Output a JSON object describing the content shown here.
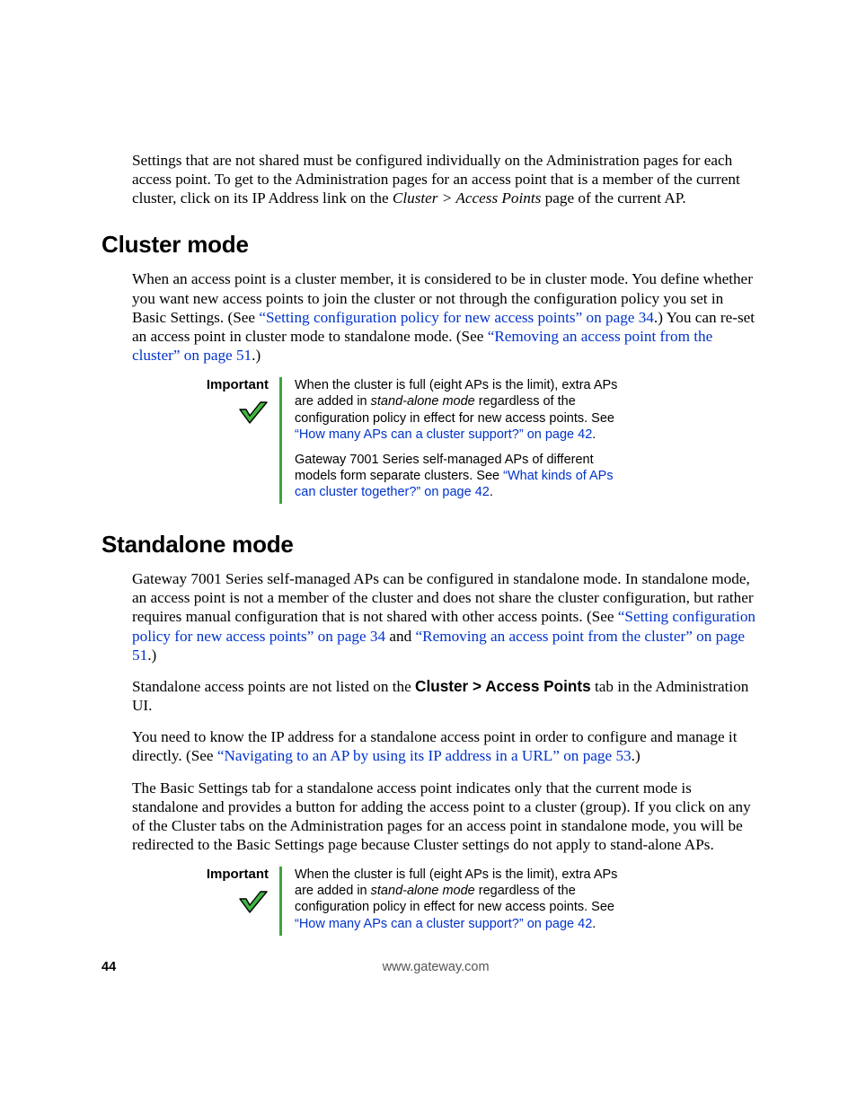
{
  "intro": {
    "p1a": "Settings that are not shared must be configured individually on the Administration pages for each access point. To get to the Administration pages for an access point that is a member of the current cluster, click on its IP Address link on the ",
    "p1b": "Cluster > Access Points",
    "p1c": " page of the current AP."
  },
  "cluster": {
    "heading": "Cluster mode",
    "p1a": "When an access point is a cluster member, it is considered to be in cluster mode. You define whether you want new access points to join the cluster or not through the configuration policy you set in Basic Settings. (See ",
    "link1": "“Setting configuration policy for new access points” on page 34",
    "p1b": ".) You can re-set an access point in cluster mode to standalone mode. (See ",
    "link2": "“Removing an access point from the cluster” on page 51",
    "p1c": ".)"
  },
  "note1": {
    "label": "Important",
    "p1a": "When the cluster is full (eight APs is the limit), extra APs are added in ",
    "p1b": "stand-alone mode",
    "p1c": " regardless of the configuration policy in effect for new access points. See ",
    "link1": "“How many APs can a cluster support?” on page 42",
    "p1d": ".",
    "p2a": "Gateway 7001 Series self-managed APs of different models form separate clusters. See ",
    "link2": "“What kinds of APs can cluster together?” on page 42",
    "p2b": "."
  },
  "standalone": {
    "heading": "Standalone mode",
    "p1a": "Gateway 7001 Series self-managed APs can be configured in standalone mode. In standalone mode, an access point is not a member of the cluster and does not share the cluster configuration, but rather requires manual configuration that is not shared with other access points. (See ",
    "link1": "“Setting configuration policy for new access points” on page 34",
    "p1b": " and ",
    "link2": "“Removing an access point from the cluster” on page 51",
    "p1c": ".)",
    "p2a": "Standalone access points are not listed on the ",
    "p2b": "Cluster > Access Points",
    "p2c": " tab in the Administration UI.",
    "p3a": "You need to know the IP address for a standalone access point in order to configure and manage it directly. (See ",
    "link3": "“Navigating to an AP by using its IP address in a URL” on page 53",
    "p3b": ".)",
    "p4": "The Basic Settings tab for a standalone access point indicates only that the current mode is standalone and provides a button for adding the access point to a cluster (group). If you click on any of the Cluster tabs on the Administration pages for an access point in standalone mode, you will be redirected to the Basic Settings page because Cluster settings do not apply to stand-alone APs."
  },
  "note2": {
    "label": "Important",
    "p1a": "When the cluster is full (eight APs is the limit), extra APs are added in ",
    "p1b": "stand-alone mode",
    "p1c": " regardless of the configuration policy in effect for new access points. See ",
    "link1": "“How many APs can a cluster support?” on page 42",
    "p1d": "."
  },
  "footer": {
    "page": "44",
    "url": "www.gateway.com"
  }
}
